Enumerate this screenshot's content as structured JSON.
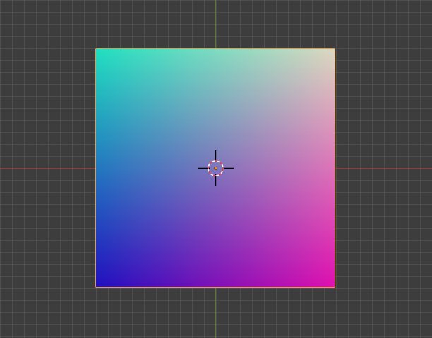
{
  "viewport": {
    "type": "3d-viewport-top-view"
  },
  "colors": {
    "background": "#3d3d3d",
    "grid_line": "#5a5a5a",
    "x_axis": "#a5323b",
    "y_axis": "#5a7d1e",
    "selection_outline": "#e89a45",
    "cursor_ring_red": "#e2363f",
    "cursor_ring_white": "#ffffff",
    "origin_dot": "#f08a3a"
  },
  "plane_object": {
    "selected": true,
    "vertex_colors": {
      "top_left": "#1fe0c0",
      "top_right": "#dcd8c0",
      "bottom_left": "#2010c0",
      "bottom_right": "#e010b0"
    }
  },
  "icons": {
    "cursor": "3d-cursor-icon",
    "origin": "object-origin-icon"
  }
}
